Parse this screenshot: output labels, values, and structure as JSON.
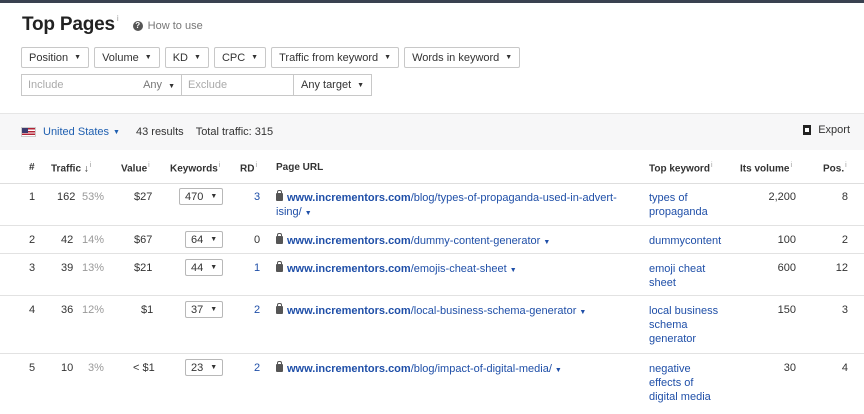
{
  "header": {
    "title": "Top Pages",
    "info": "i",
    "how_to_use": "How to use",
    "howto_icon": "?"
  },
  "filters": [
    {
      "label": "Position"
    },
    {
      "label": "Volume"
    },
    {
      "label": "KD"
    },
    {
      "label": "CPC"
    },
    {
      "label": "Traffic from keyword"
    },
    {
      "label": "Words in keyword"
    }
  ],
  "search": {
    "include_placeholder": "Include",
    "include_mode": "Any",
    "exclude_placeholder": "Exclude",
    "target": "Any target"
  },
  "summary": {
    "country": "United States",
    "results": "43 results",
    "total_traffic": "Total traffic: 315",
    "export": "Export"
  },
  "columns": {
    "num": "#",
    "traffic": "Traffic",
    "traffic_sort": "↓",
    "value": "Value",
    "keywords": "Keywords",
    "rd": "RD",
    "page_url": "Page URL",
    "top_keyword": "Top keyword",
    "its_volume": "Its volume",
    "pos": "Pos."
  },
  "rows": [
    {
      "num": "1",
      "traffic": "162",
      "pct": "53%",
      "value": "$27",
      "keywords": "470",
      "rd": "3",
      "url_domain": "www.incrementors.com",
      "url_path": "/blog/types-of-propaganda-used-in-advert-",
      "url_path2": "ising/",
      "top_keyword": "types of propaganda",
      "volume": "2,200",
      "pos": "8"
    },
    {
      "num": "2",
      "traffic": "42",
      "pct": "14%",
      "value": "$67",
      "keywords": "64",
      "rd": "0",
      "url_domain": "www.incrementors.com",
      "url_path": "/dummy-content-generator",
      "top_keyword": "dummycontent",
      "volume": "100",
      "pos": "2"
    },
    {
      "num": "3",
      "traffic": "39",
      "pct": "13%",
      "value": "$21",
      "keywords": "44",
      "rd": "1",
      "url_domain": "www.incrementors.com",
      "url_path": "/emojis-cheat-sheet",
      "top_keyword": "emoji cheat sheet",
      "volume": "600",
      "pos": "12"
    },
    {
      "num": "4",
      "traffic": "36",
      "pct": "12%",
      "value": "$1",
      "keywords": "37",
      "rd": "2",
      "url_domain": "www.incrementors.com",
      "url_path": "/local-business-schema-generator",
      "top_keyword": "local business schema generator",
      "volume": "150",
      "pos": "3"
    },
    {
      "num": "5",
      "traffic": "10",
      "pct": "3%",
      "value": "< $1",
      "keywords": "23",
      "rd": "2",
      "url_domain": "www.incrementors.com",
      "url_path": "/blog/impact-of-digital-media/",
      "top_keyword": "negative effects of digital media",
      "volume": "30",
      "pos": "4"
    }
  ]
}
